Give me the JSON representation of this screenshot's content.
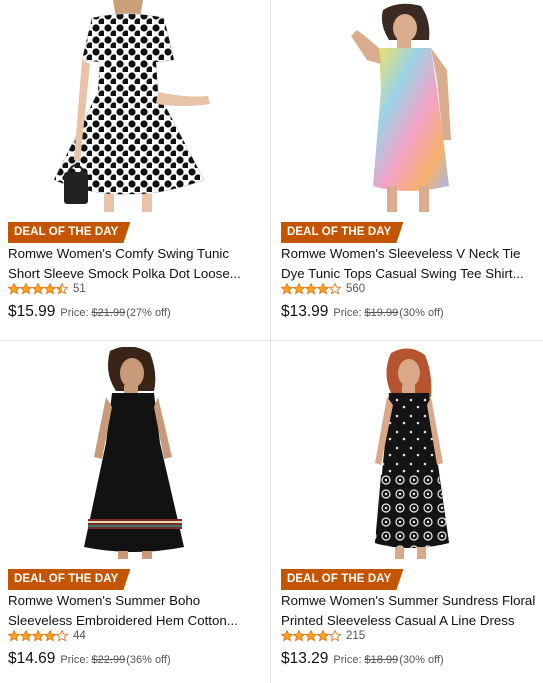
{
  "products": [
    {
      "badge": "DEAL OF THE DAY",
      "title_line1": "Romwe Women's Comfy Swing Tunic",
      "title_line2": "Short Sleeve Smock Polka Dot Loose...",
      "rating": 4.5,
      "reviews": "51",
      "price": "$15.99",
      "price_label": "Price:",
      "was_price": "$21.99",
      "discount": "(27% off)",
      "image_icon": "polka-dot-dress-photo"
    },
    {
      "badge": "DEAL OF THE DAY",
      "title_line1": "Romwe Women's Sleeveless V Neck Tie",
      "title_line2": "Dye Tunic Tops Casual Swing Tee Shirt...",
      "rating": 4,
      "reviews": "560",
      "price": "$13.99",
      "price_label": "Price:",
      "was_price": "$19.99",
      "discount": "(30% off)",
      "image_icon": "tie-dye-dress-photo"
    },
    {
      "badge": "DEAL OF THE DAY",
      "title_line1": "Romwe Women's Summer Boho",
      "title_line2": "Sleeveless Embroidered Hem Cotton...",
      "rating": 4,
      "reviews": "44",
      "price": "$14.69",
      "price_label": "Price:",
      "was_price": "$22.99",
      "discount": "(36% off)",
      "image_icon": "black-boho-dress-photo"
    },
    {
      "badge": "DEAL OF THE DAY",
      "title_line1": "Romwe Women's Summer Sundress Floral",
      "title_line2": "Printed Sleeveless Casual A Line Dress",
      "rating": 4,
      "reviews": "215",
      "price": "$13.29",
      "price_label": "Price:",
      "was_price": "$18.99",
      "discount": "(30% off)",
      "image_icon": "floral-sundress-photo"
    }
  ],
  "colors": {
    "badge": "#c45500",
    "star_fill": "#ffa41c",
    "star_stroke": "#de7921",
    "divider": "#e3e3e3"
  }
}
